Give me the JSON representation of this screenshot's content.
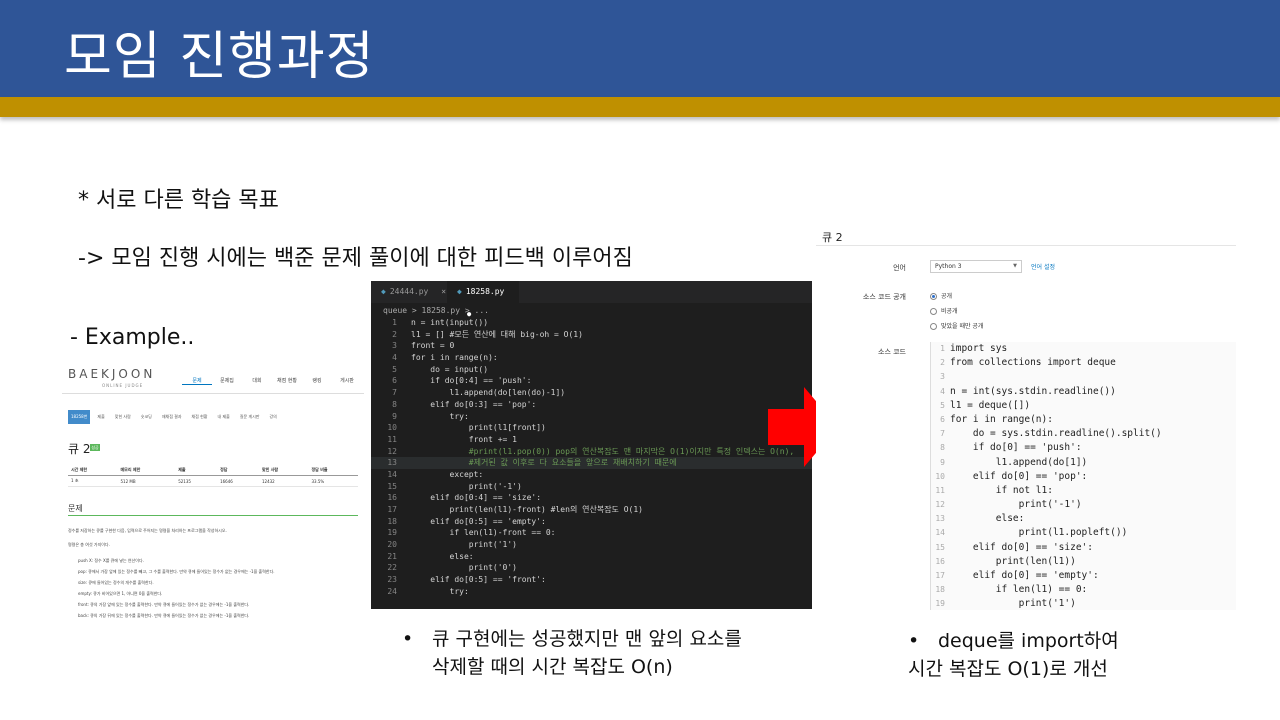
{
  "slide": {
    "title": "모임 진행과정",
    "point1": "* 서로 다른 학습 목표",
    "point2": "-> 모임 진행 시에는 백준 문제 풀이에 대한 피드백 이루어짐",
    "example": "- Example..",
    "bullet_left_1": "큐 구현에는 성공했지만 맨 앞의 요소를",
    "bullet_left_2": "삭제할 때의 시간 복잡도 O(n)",
    "bullet_right_1": "deque를 import하여",
    "bullet_right_2": "시간 복잡도 O(1)로 개선",
    "bullet_symbol": "•"
  },
  "colors": {
    "title_bar": "#2f5597",
    "gold_bar": "#bf9000",
    "arrow": "#ff0000",
    "editor_bg": "#1e1e1e"
  },
  "baekjoon": {
    "logo": "BAEKJOON",
    "logo_sub": "ONLINE JUDGE",
    "nav": [
      "문제",
      "문제집",
      "대회",
      "채점 현황",
      "랭킹",
      "게시판"
    ],
    "tabs": [
      "18258번",
      "제출",
      "맞힌 사람",
      "숏코딩",
      "재채점 결과",
      "채점 현황",
      "내 제출",
      "질문 게시판",
      "강의"
    ],
    "problem_title": "큐 2",
    "badge": "성공",
    "table_header": [
      "시간 제한",
      "메모리 제한",
      "제출",
      "정답",
      "맞힌 사람",
      "정답 비율"
    ],
    "table_row": [
      "1 초",
      "512 MB",
      "52135",
      "16646",
      "12432",
      "33.5%"
    ],
    "section": "문제",
    "desc1": "정수를 저장하는 큐를 구현한 다음, 입력으로 주어지는 명령을 처리하는 프로그램을 작성하시오.",
    "desc2": "명령은 총 여섯 가지이다.",
    "commands": [
      "push X: 정수 X를 큐에 넣는 연산이다.",
      "pop: 큐에서 가장 앞에 있는 정수를 빼고, 그 수를 출력한다. 만약 큐에 들어있는 정수가 없는 경우에는 -1을 출력한다.",
      "size: 큐에 들어있는 정수의 개수를 출력한다.",
      "empty: 큐가 비어있으면 1, 아니면 0을 출력한다.",
      "front: 큐의 가장 앞에 있는 정수를 출력한다. 만약 큐에 들어있는 정수가 없는 경우에는 -1을 출력한다.",
      "back: 큐의 가장 뒤에 있는 정수를 출력한다. 만약 큐에 들어있는 정수가 없는 경우에는 -1을 출력한다."
    ]
  },
  "editor": {
    "tab1": "24444.py",
    "tab1_close": "×",
    "tab2": "18258.py",
    "tab2_dot": "●",
    "breadcrumb": "queue > 18258.py > ...",
    "current_line": 13,
    "lines": [
      {
        "n": 1,
        "t": "n = int(input())",
        "c": ""
      },
      {
        "n": 2,
        "t": "l1 = [] #모든 연산에 대해 big-oh = O(1)",
        "c": ""
      },
      {
        "n": 3,
        "t": "front = 0",
        "c": ""
      },
      {
        "n": 4,
        "t": "for i in range(n):",
        "c": ""
      },
      {
        "n": 5,
        "t": "    do = input()",
        "c": ""
      },
      {
        "n": 6,
        "t": "    if do[0:4] == 'push':",
        "c": ""
      },
      {
        "n": 7,
        "t": "        l1.append(do[len(do)-1])",
        "c": ""
      },
      {
        "n": 8,
        "t": "    elif do[0:3] == 'pop':",
        "c": ""
      },
      {
        "n": 9,
        "t": "        try:",
        "c": ""
      },
      {
        "n": 10,
        "t": "            print(l1[front])",
        "c": ""
      },
      {
        "n": 11,
        "t": "            front += 1",
        "c": ""
      },
      {
        "n": 12,
        "t": "            #print(l1.pop(0)) pop의 연산복잡도 맨 마지막은 O(1)이지만 특정 인덱스는 O(n),",
        "c": "cm"
      },
      {
        "n": 13,
        "t": "            #제거된 값 이후로 다 요소들을 앞으로 재배치하기 때문에",
        "c": "cm"
      },
      {
        "n": 14,
        "t": "        except:",
        "c": ""
      },
      {
        "n": 15,
        "t": "            print('-1')",
        "c": ""
      },
      {
        "n": 16,
        "t": "    elif do[0:4] == 'size':",
        "c": ""
      },
      {
        "n": 17,
        "t": "        print(len(l1)-front) #len의 연산복잡도 O(1)",
        "c": ""
      },
      {
        "n": 18,
        "t": "    elif do[0:5] == 'empty':",
        "c": ""
      },
      {
        "n": 19,
        "t": "        if len(l1)-front == 0:",
        "c": ""
      },
      {
        "n": 20,
        "t": "            print('1')",
        "c": ""
      },
      {
        "n": 21,
        "t": "        else:",
        "c": ""
      },
      {
        "n": 22,
        "t": "            print('0')",
        "c": ""
      },
      {
        "n": 23,
        "t": "    elif do[0:5] == 'front':",
        "c": ""
      },
      {
        "n": 24,
        "t": "        try:",
        "c": ""
      }
    ]
  },
  "submit": {
    "title": "큐 2",
    "lang_label": "언어",
    "lang_value": "Python 3",
    "lang_link": "언어 설정",
    "visibility_label": "소스 코드 공개",
    "visibility_options": [
      "공개",
      "비공개",
      "맞았을 때만 공개"
    ],
    "visibility_selected": 0,
    "code_label": "소스 코드",
    "code_lines": [
      "import sys",
      "from collections import deque",
      "",
      "n = int(sys.stdin.readline())",
      "l1 = deque([])",
      "for i in range(n):",
      "    do = sys.stdin.readline().split()",
      "    if do[0] == 'push':",
      "        l1.append(do[1])",
      "    elif do[0] == 'pop':",
      "        if not l1:",
      "            print('-1')",
      "        else:",
      "            print(l1.popleft())",
      "    elif do[0] == 'size':",
      "        print(len(l1))",
      "    elif do[0] == 'empty':",
      "        if len(l1) == 0:",
      "            print('1')"
    ]
  }
}
